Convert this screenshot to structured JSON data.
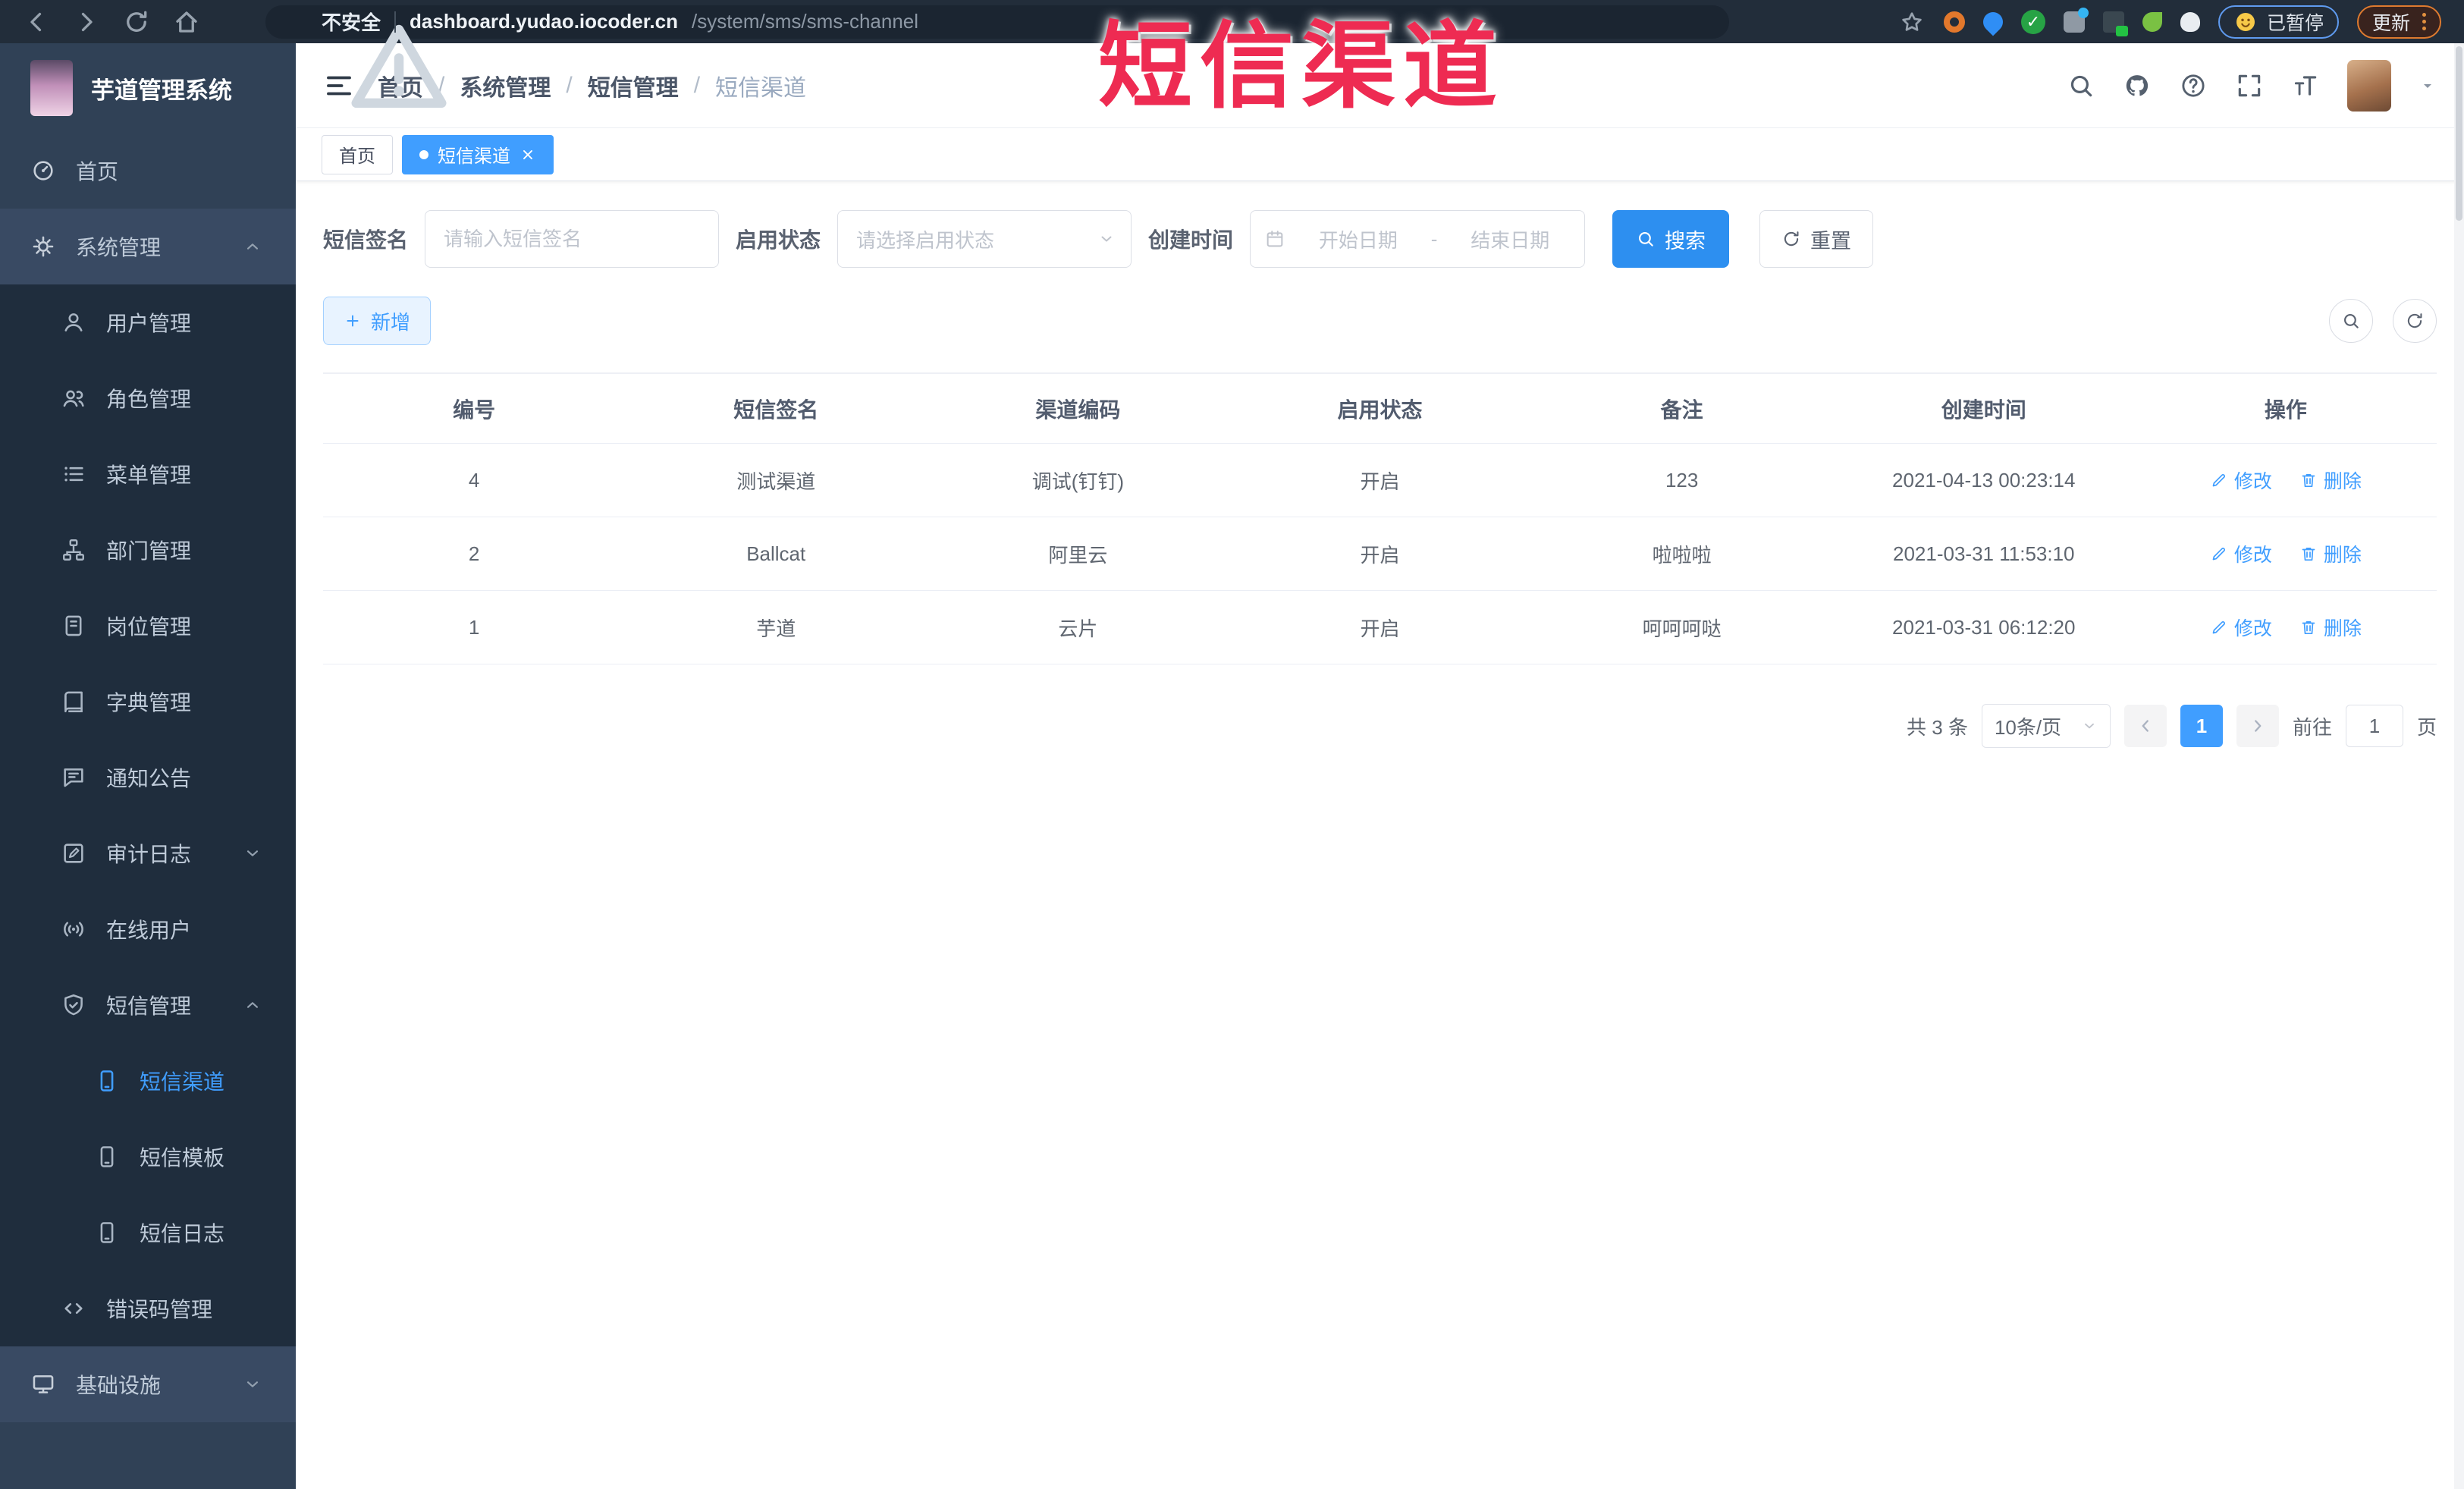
{
  "browser": {
    "security_label": "不安全",
    "url_host": "dashboard.yudao.iocoder.cn",
    "url_path": "/system/sms/sms-channel",
    "paused_badge": "已暂停",
    "update_button": "更新"
  },
  "annotation": {
    "text": "短信渠道",
    "color": "#ee2b52"
  },
  "sidebar": {
    "logo_title": "芋道管理系统",
    "items": [
      {
        "label": "首页"
      },
      {
        "label": "系统管理"
      },
      {
        "label": "用户管理"
      },
      {
        "label": "角色管理"
      },
      {
        "label": "菜单管理"
      },
      {
        "label": "部门管理"
      },
      {
        "label": "岗位管理"
      },
      {
        "label": "字典管理"
      },
      {
        "label": "通知公告"
      },
      {
        "label": "审计日志"
      },
      {
        "label": "在线用户"
      },
      {
        "label": "短信管理"
      },
      {
        "label": "短信渠道"
      },
      {
        "label": "短信模板"
      },
      {
        "label": "短信日志"
      },
      {
        "label": "错误码管理"
      },
      {
        "label": "基础设施"
      }
    ]
  },
  "header": {
    "breadcrumb": [
      "首页",
      "系统管理",
      "短信管理",
      "短信渠道"
    ],
    "separator": "/"
  },
  "tabs": [
    {
      "label": "首页"
    },
    {
      "label": "短信渠道"
    }
  ],
  "filters": {
    "sign_label": "短信签名",
    "sign_placeholder": "请输入短信签名",
    "status_label": "启用状态",
    "status_placeholder": "请选择启用状态",
    "time_label": "创建时间",
    "date_start_placeholder": "开始日期",
    "date_separator": "-",
    "date_end_placeholder": "结束日期",
    "search_label": "搜索",
    "reset_label": "重置"
  },
  "toolbar": {
    "add_label": "新增"
  },
  "table": {
    "columns": [
      "编号",
      "短信签名",
      "渠道编码",
      "启用状态",
      "备注",
      "创建时间",
      "操作"
    ],
    "rows": [
      {
        "id": "4",
        "sign": "测试渠道",
        "code": "调试(钉钉)",
        "status": "开启",
        "remark": "123",
        "created": "2021-04-13 00:23:14"
      },
      {
        "id": "2",
        "sign": "Ballcat",
        "code": "阿里云",
        "status": "开启",
        "remark": "啦啦啦",
        "created": "2021-03-31 11:53:10"
      },
      {
        "id": "1",
        "sign": "芋道",
        "code": "云片",
        "status": "开启",
        "remark": "呵呵呵哒",
        "created": "2021-03-31 06:12:20"
      }
    ],
    "edit_label": "修改",
    "delete_label": "删除"
  },
  "pagination": {
    "total_text": "共 3 条",
    "page_size": "10条/页",
    "current_page": "1",
    "goto_label": "前往",
    "goto_value": "1",
    "page_suffix": "页"
  },
  "theme": {
    "accent_blue": "#409eff",
    "sidebar_bg": "#304156",
    "submenu_bg": "#1f2d3d"
  }
}
